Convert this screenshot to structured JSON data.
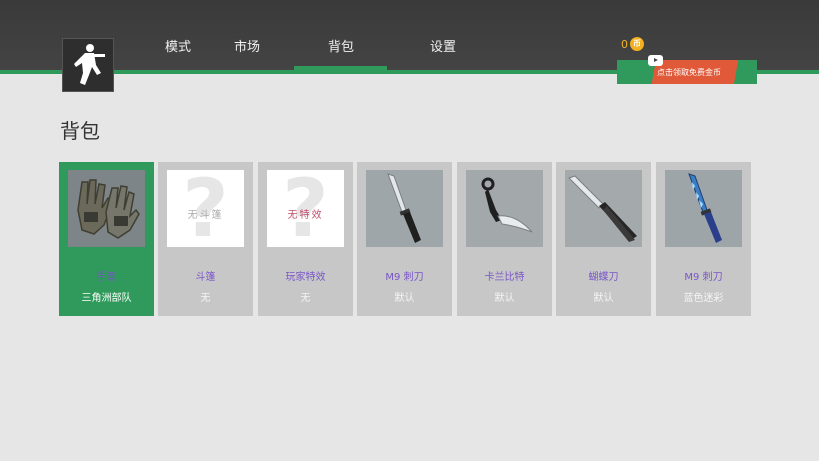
{
  "nav": {
    "items": [
      {
        "label": "模式"
      },
      {
        "label": "市场"
      },
      {
        "label": "背包"
      },
      {
        "label": "设置"
      }
    ],
    "active": "背包"
  },
  "coins": {
    "count": "0",
    "icon": "coin-icon",
    "symbol": "币"
  },
  "promo": {
    "label": "点击领取免费金币",
    "icon": "play-video-icon"
  },
  "page": {
    "title": "背包"
  },
  "colors": {
    "accent": "#2f9a5b",
    "name_text": "#7a55c8",
    "promo": "#e05a3a",
    "coin": "#f2b01e"
  },
  "inventory": [
    {
      "name": "手套",
      "skin": "三角洲部队",
      "icon": "gloves-icon",
      "placeholder_text": ""
    },
    {
      "name": "斗篷",
      "skin": "无",
      "icon": "question-mark-icon",
      "placeholder_text": "无斗篷"
    },
    {
      "name": "玩家特效",
      "skin": "无",
      "icon": "question-mark-icon",
      "placeholder_text": "无特效"
    },
    {
      "name": "M9 刺刀",
      "skin": "默认",
      "icon": "bayonet-knife-icon",
      "placeholder_text": ""
    },
    {
      "name": "卡兰比特",
      "skin": "默认",
      "icon": "karambit-icon",
      "placeholder_text": ""
    },
    {
      "name": "蝴蝶刀",
      "skin": "默认",
      "icon": "butterfly-knife-icon",
      "placeholder_text": ""
    },
    {
      "name": "M9 刺刀",
      "skin": "蓝色迷彩",
      "icon": "bayonet-knife-blue-camo-icon",
      "placeholder_text": ""
    }
  ]
}
